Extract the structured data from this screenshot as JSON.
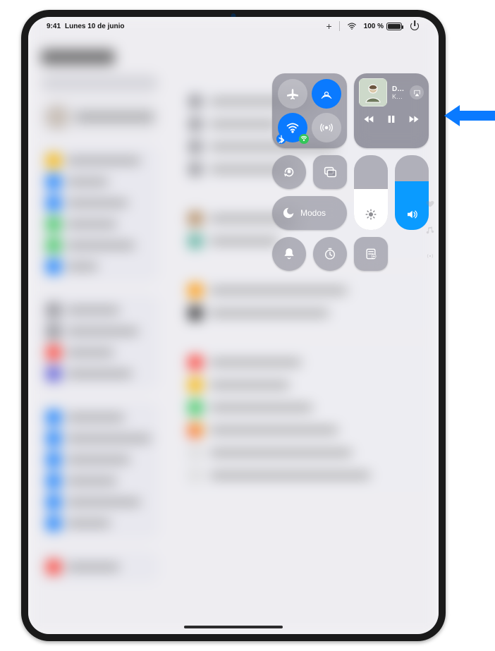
{
  "status": {
    "time": "9:41",
    "date": "Lunes 10 de junio",
    "battery_text": "100 %",
    "battery_level": 100
  },
  "connectivity": {
    "airplane_name": "airplane-mode",
    "airdrop_name": "airdrop",
    "wifi_name": "wifi",
    "bluetooth_name": "bluetooth"
  },
  "media": {
    "song_title": "Deeper Well",
    "artist": "Kacey Musgraves",
    "is_playing": false
  },
  "focus": {
    "label": "Modos"
  },
  "brightness": {
    "level_pct": 55
  },
  "volume": {
    "level_pct": 65
  },
  "icons": {
    "rotation_lock": "rotation-lock",
    "screen_mirroring": "screen-mirroring",
    "silent": "silent-mode",
    "timer": "timer",
    "quick_note": "quick-note",
    "heart": "favorite",
    "music": "music",
    "camera": "camera-toggle"
  }
}
